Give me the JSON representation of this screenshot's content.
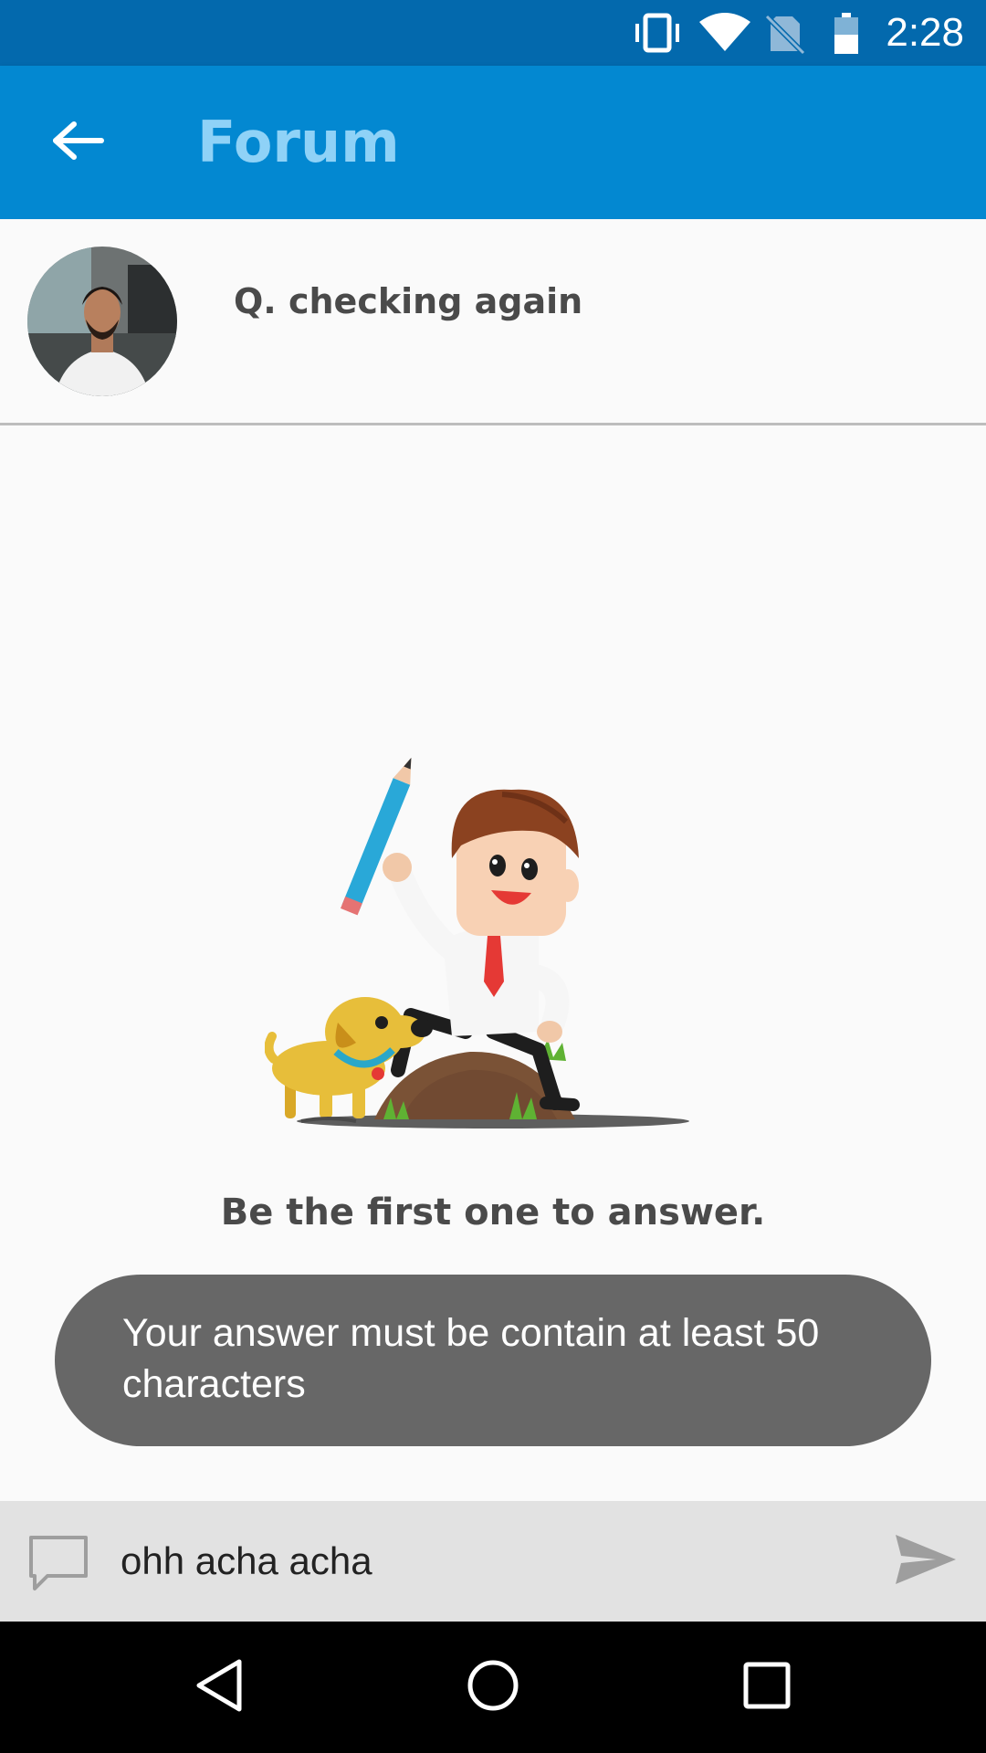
{
  "status_bar": {
    "time": "2:28",
    "icons": [
      "vibrate-icon",
      "wifi-icon",
      "no-sim-icon",
      "battery-icon"
    ]
  },
  "app_bar": {
    "back_icon": "arrow-left-icon",
    "title": "Forum"
  },
  "question": {
    "avatar_icon": "user-avatar",
    "text": "Q. checking again"
  },
  "empty_state": {
    "illustration": "cartoon-man-with-pencil-and-dog",
    "message": "Be the first one to answer."
  },
  "toast": {
    "message": "Your answer must be contain at least 50 characters"
  },
  "composer": {
    "comment_icon": "comment-icon",
    "input_value": "ohh acha acha",
    "send_icon": "send-icon"
  },
  "nav_bar": {
    "back": "nav-back-icon",
    "home": "nav-home-icon",
    "recents": "nav-recents-icon"
  },
  "colors": {
    "status_bar": "#0369ad",
    "app_bar": "#0388d1",
    "title_text": "#8fd2f7",
    "toast_bg": "#676767",
    "composer_bg": "#e2e2e2"
  }
}
